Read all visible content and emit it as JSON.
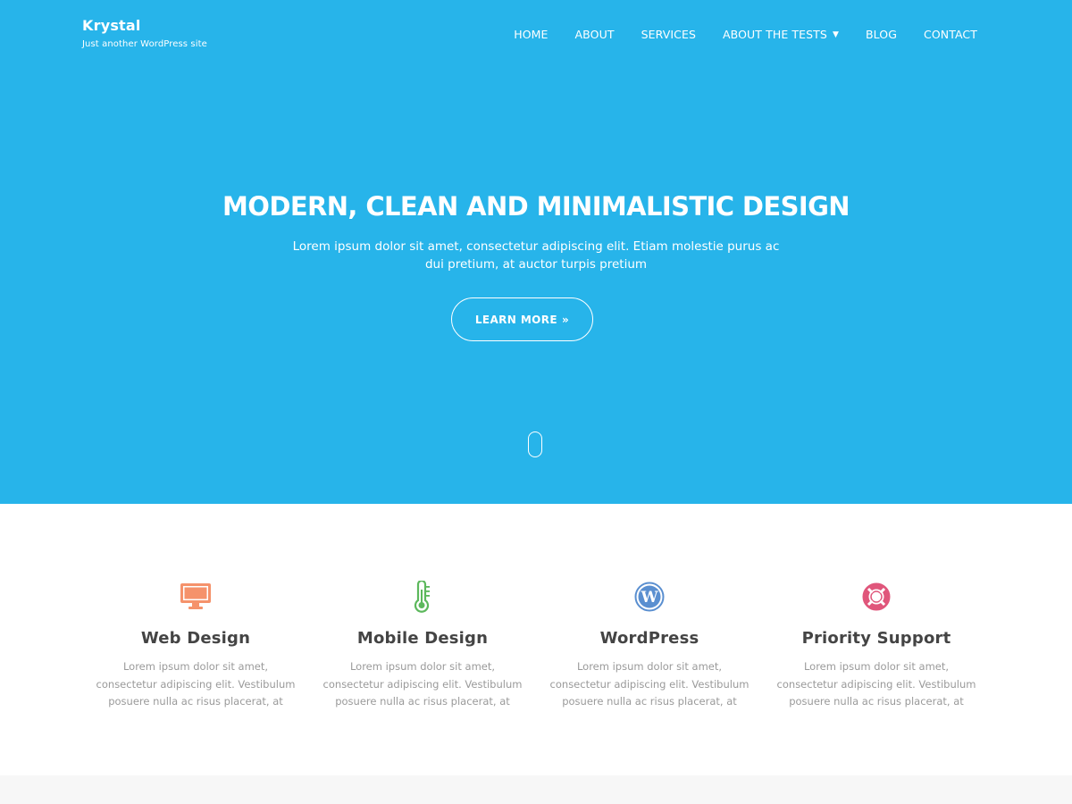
{
  "brand": {
    "title": "Krystal",
    "tagline": "Just another WordPress site"
  },
  "nav": [
    {
      "label": "HOME"
    },
    {
      "label": "ABOUT"
    },
    {
      "label": "SERVICES"
    },
    {
      "label": "ABOUT THE TESTS",
      "has_dropdown": true
    },
    {
      "label": "BLOG"
    },
    {
      "label": "CONTACT"
    }
  ],
  "hero": {
    "title": "MODERN, CLEAN AND MINIMALISTIC DESIGN",
    "subtitle": "Lorem ipsum dolor sit amet, consectetur adipiscing elit. Etiam molestie purus ac dui pretium, at auctor turpis pretium",
    "cta_label": "LEARN MORE",
    "cta_icon": "double-chevron-right-icon",
    "background_color": "#27b4ea"
  },
  "features": [
    {
      "icon": "monitor-icon",
      "color": "#f5926b",
      "title": "Web Design",
      "text": "Lorem ipsum dolor sit amet, consectetur adipiscing elit. Vestibulum posuere nulla ac risus placerat, at"
    },
    {
      "icon": "thermometer-icon",
      "color": "#5cb85c",
      "title": "Mobile Design",
      "text": "Lorem ipsum dolor sit amet, consectetur adipiscing elit. Vestibulum posuere nulla ac risus placerat, at"
    },
    {
      "icon": "wordpress-icon",
      "color": "#5a8fd0",
      "title": "WordPress",
      "text": "Lorem ipsum dolor sit amet, consectetur adipiscing elit. Vestibulum posuere nulla ac risus placerat, at"
    },
    {
      "icon": "life-ring-icon",
      "color": "#e0567b",
      "title": "Priority Support",
      "text": "Lorem ipsum dolor sit amet, consectetur adipiscing elit. Vestibulum posuere nulla ac risus placerat, at"
    }
  ]
}
